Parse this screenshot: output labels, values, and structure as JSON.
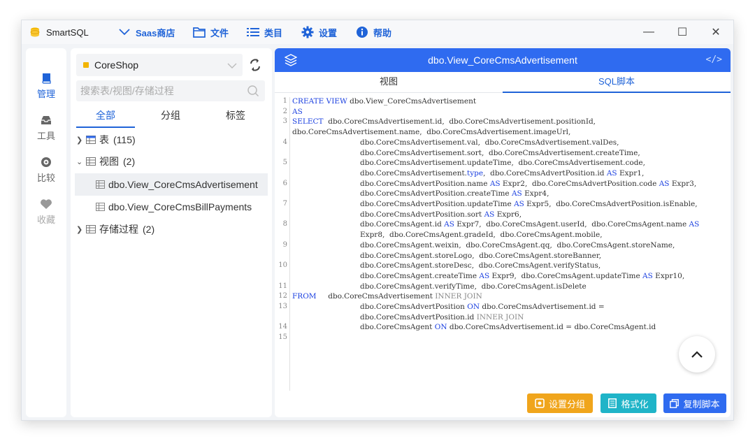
{
  "titlebar": {
    "app_name": "SmartSQL",
    "menus": [
      {
        "label": "Saas商店",
        "icon": "chevron-down-icon"
      },
      {
        "label": "文件",
        "icon": "folder-icon"
      },
      {
        "label": "类目",
        "icon": "list-icon"
      },
      {
        "label": "设置",
        "icon": "gear-icon"
      },
      {
        "label": "帮助",
        "icon": "info-icon"
      }
    ],
    "minimize": "—",
    "maximize": "☐",
    "close": "✕"
  },
  "rail": {
    "items": [
      {
        "label": "管理",
        "icon": "book-icon",
        "active": true
      },
      {
        "label": "工具",
        "icon": "tray-icon",
        "active": false
      },
      {
        "label": "比较",
        "icon": "compass-icon",
        "active": false
      },
      {
        "label": "收藏",
        "icon": "heart-icon",
        "active": false
      }
    ]
  },
  "tree_panel": {
    "database": "CoreShop",
    "search_placeholder": "搜索表/视图/存储过程",
    "tabs": [
      "全部",
      "分组",
      "标签"
    ],
    "tables": {
      "label": "表",
      "count": "(115)"
    },
    "views": {
      "label": "视图",
      "count": "(2)"
    },
    "view_items": [
      "dbo.View_CoreCmsAdvertisement",
      "dbo.View_CoreCmsBillPayments"
    ],
    "procs": {
      "label": "存储过程",
      "count": "(2)"
    }
  },
  "editor": {
    "title": "dbo.View_CoreCmsAdvertisement",
    "code_icon": "</>",
    "tabs": [
      "视图",
      "SQL脚本"
    ],
    "active_tab": "SQL脚本",
    "line_numbers": [
      "1",
      "2",
      "3",
      "4",
      "5",
      "6",
      "7",
      "8",
      "9",
      "10",
      "11",
      "12",
      "13",
      "14",
      "15"
    ],
    "code_lines": [
      "CREATE VIEW dbo.View_CoreCmsAdvertisement",
      "AS",
      "SELECT  dbo.CoreCmsAdvertisement.id,  dbo.CoreCmsAdvertisement.positionId,",
      "dbo.CoreCmsAdvertisement.name,  dbo.CoreCmsAdvertisement.imageUrl,",
      "dbo.CoreCmsAdvertisement.val,  dbo.CoreCmsAdvertisement.valDes,",
      "dbo.CoreCmsAdvertisement.sort,  dbo.CoreCmsAdvertisement.createTime,",
      "dbo.CoreCmsAdvertisement.updateTime,  dbo.CoreCmsAdvertisement.code,",
      "dbo.CoreCmsAdvertisement.type,  dbo.CoreCmsAdvertPosition.id AS Expr1,",
      "dbo.CoreCmsAdvertPosition.name AS Expr2,  dbo.CoreCmsAdvertPosition.code AS Expr3,",
      "dbo.CoreCmsAdvertPosition.createTime AS Expr4,",
      "dbo.CoreCmsAdvertPosition.updateTime AS Expr5,  dbo.CoreCmsAdvertPosition.isEnable,",
      "dbo.CoreCmsAdvertPosition.sort AS Expr6,",
      "dbo.CoreCmsAgent.id AS Expr7,  dbo.CoreCmsAgent.userId,  dbo.CoreCmsAgent.name AS",
      "Expr8,  dbo.CoreCmsAgent.gradeId,  dbo.CoreCmsAgent.mobile,",
      "dbo.CoreCmsAgent.weixin,  dbo.CoreCmsAgent.qq,  dbo.CoreCmsAgent.storeName,",
      "dbo.CoreCmsAgent.storeLogo,  dbo.CoreCmsAgent.storeBanner,",
      "dbo.CoreCmsAgent.storeDesc,  dbo.CoreCmsAgent.verifyStatus,",
      "dbo.CoreCmsAgent.createTime AS Expr9,  dbo.CoreCmsAgent.updateTime AS Expr10,",
      "dbo.CoreCmsAgent.verifyTime,  dbo.CoreCmsAgent.isDelete",
      "FROM     dbo.CoreCmsAdvertisement INNER JOIN",
      "dbo.CoreCmsAdvertPosition ON dbo.CoreCmsAdvertisement.id =",
      "dbo.CoreCmsAdvertPosition.id INNER JOIN",
      "dbo.CoreCmsAgent ON dbo.CoreCmsAdvertisement.id = dbo.CoreCmsAgent.id"
    ],
    "buttons": [
      {
        "label": "设置分组",
        "icon": "group-icon",
        "color": "#f0a51c"
      },
      {
        "label": "格式化",
        "icon": "format-icon",
        "color": "#1fb4c8"
      },
      {
        "label": "复制脚本",
        "icon": "copy-icon",
        "color": "#2f6bf0"
      }
    ]
  },
  "colors": {
    "accent": "#2f6bf0",
    "brand_text": "#1f63d8"
  }
}
